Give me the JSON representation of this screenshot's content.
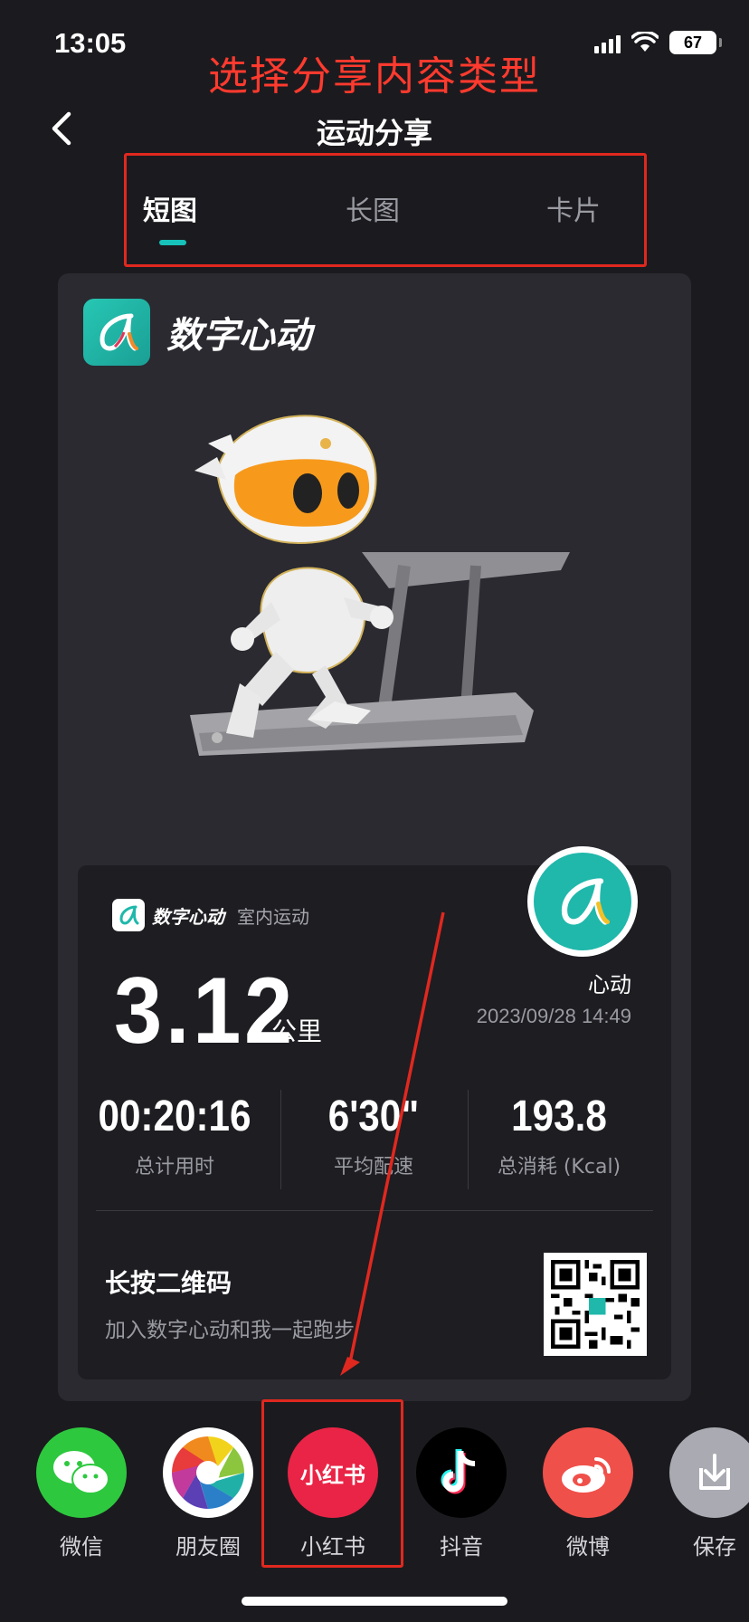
{
  "status": {
    "time": "13:05",
    "battery": "67"
  },
  "annotation": {
    "title": "选择分享内容类型"
  },
  "nav": {
    "title": "运动分享"
  },
  "tabs": [
    {
      "label": "短图",
      "active": true
    },
    {
      "label": "长图",
      "active": false
    },
    {
      "label": "卡片",
      "active": false
    }
  ],
  "brand": {
    "name": "数字心动"
  },
  "workout": {
    "brand": "数字心动",
    "type": "室内运动",
    "nickname": "心动",
    "datetime": "2023/09/28 14:49",
    "distance": "3.12",
    "distance_unit": "公里",
    "metrics": [
      {
        "value": "00:20:16",
        "label": "总计用时"
      },
      {
        "value": "6'30\"",
        "label": "平均配速"
      },
      {
        "value": "193.8",
        "label": "总消耗 (Kcal)"
      }
    ],
    "qr_title": "长按二维码",
    "qr_subtitle": "加入数字心动和我一起跑步"
  },
  "share": [
    {
      "label": "微信",
      "color": "#2ec83f"
    },
    {
      "label": "朋友圈",
      "color": "#ffffff"
    },
    {
      "label": "小红书",
      "icon_text": "小红书",
      "color": "#ea2446"
    },
    {
      "label": "抖音",
      "color": "#000000"
    },
    {
      "label": "微博",
      "color": "#f0504a"
    },
    {
      "label": "保存",
      "color": "#a9aab2"
    }
  ]
}
